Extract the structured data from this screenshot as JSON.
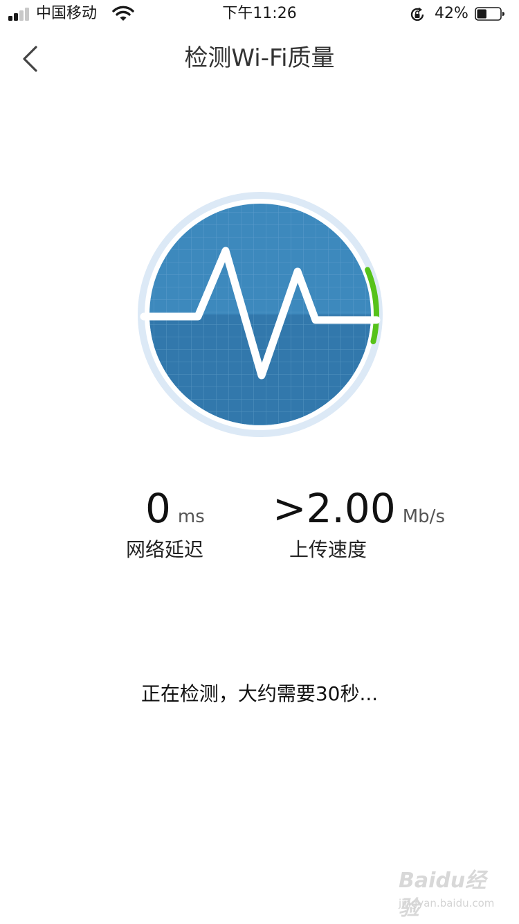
{
  "status_bar": {
    "carrier": "中国移动",
    "time": "下午11:26",
    "battery_percent": "42%",
    "battery_level": 0.42,
    "signal_bars": 2,
    "icons": [
      "signal-icon",
      "wifi-icon",
      "rotation-lock-icon",
      "battery-icon"
    ]
  },
  "nav": {
    "back_icon": "chevron-left-icon",
    "title": "检测Wi-Fi质量"
  },
  "gauge": {
    "icon": "heartbeat-icon",
    "progress": 0.1,
    "colors": {
      "disc": "#3d89bd",
      "disc_dark": "#3278ac",
      "ring": "#dce9f6",
      "progress": "#56c21a",
      "pulse": "#ffffff"
    }
  },
  "metrics": {
    "latency": {
      "value": "0",
      "unit": "ms",
      "label": "网络延迟"
    },
    "upload": {
      "value": ">2.00",
      "unit": "Mb/s",
      "label": "上传速度"
    }
  },
  "status_message": "正在检测，大约需要30秒...",
  "watermark": {
    "main": "Baidu经验",
    "sub": "jingyan.baidu.com"
  }
}
